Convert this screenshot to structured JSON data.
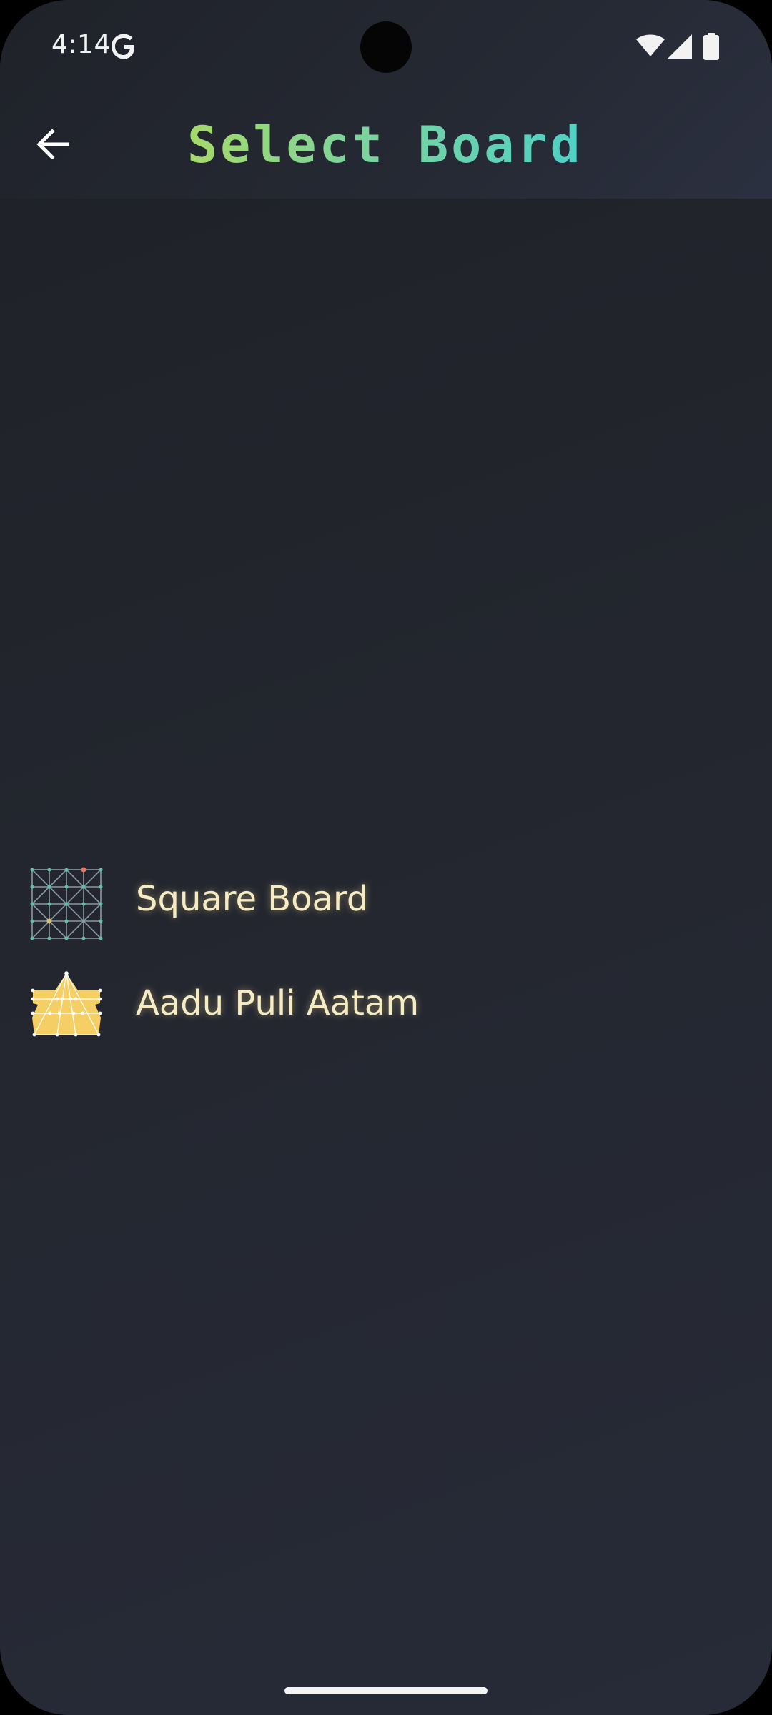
{
  "status_bar": {
    "time": "4:14",
    "icons": [
      "google-icon",
      "wifi-icon",
      "signal-icon",
      "battery-icon"
    ]
  },
  "app_bar": {
    "title": "Select Board",
    "back_icon": "arrow-left-icon"
  },
  "boards": [
    {
      "label": "Square Board",
      "icon": "square-board-icon"
    },
    {
      "label": "Aadu Puli Aatam",
      "icon": "aadu-puli-board-icon"
    }
  ],
  "colors": {
    "background": "#23262e",
    "title_gradient_start": "#a6d96a",
    "title_gradient_end": "#4fd0c6",
    "item_text": "#f5ecc4",
    "aadu_puli_fill": "#f6cf64"
  }
}
